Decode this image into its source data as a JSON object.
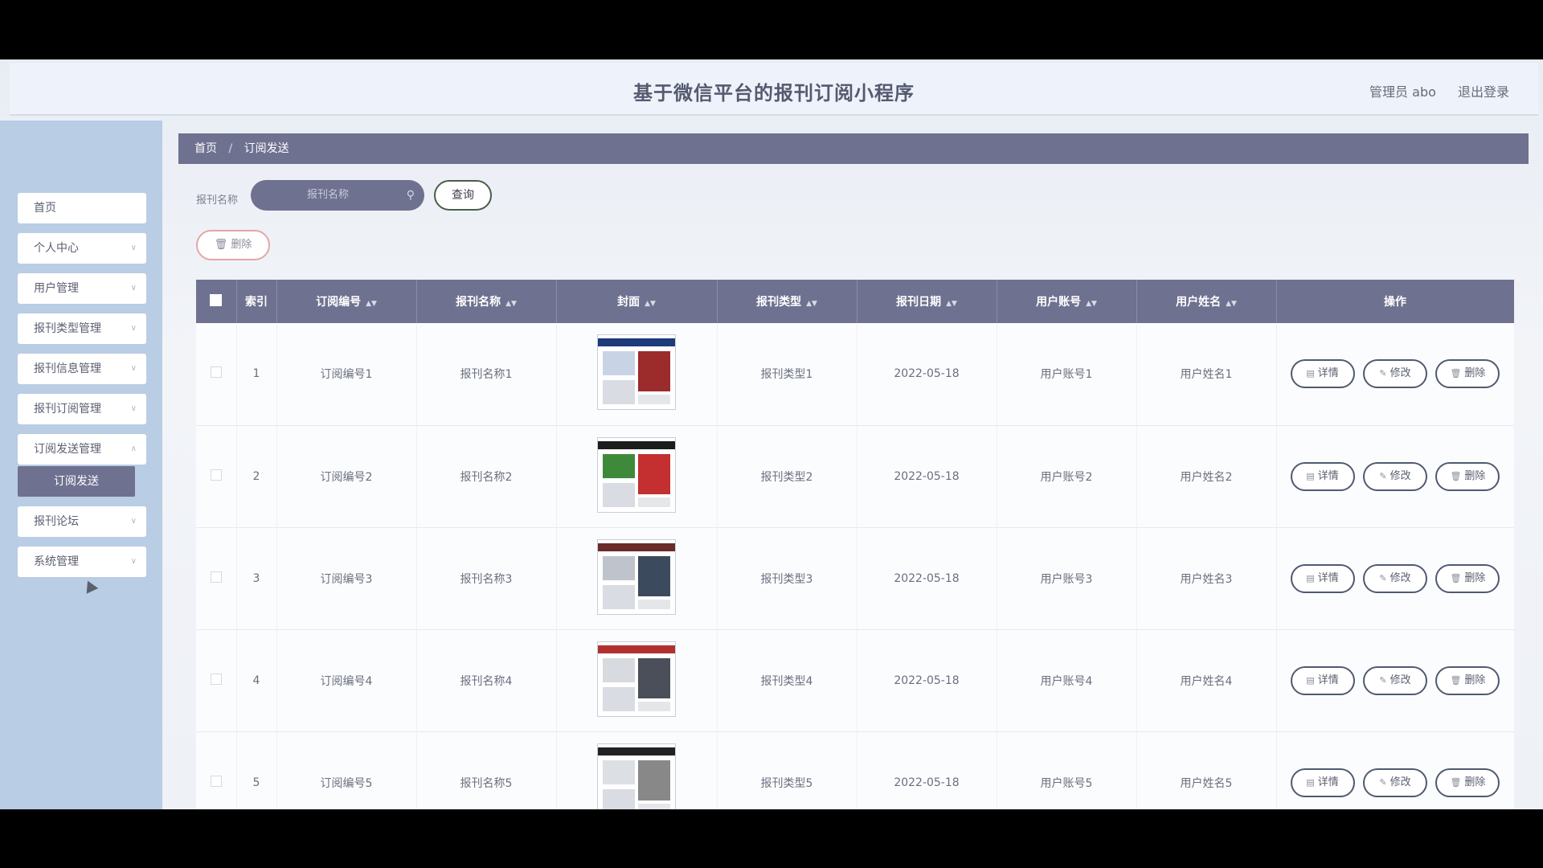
{
  "header": {
    "title": "基于微信平台的报刊订阅小程序",
    "admin_label": "管理员 abo",
    "logout_label": "退出登录"
  },
  "sidebar": {
    "items": [
      {
        "label": "首页"
      },
      {
        "label": "个人中心"
      },
      {
        "label": "用户管理"
      },
      {
        "label": "报刊类型管理"
      },
      {
        "label": "报刊信息管理"
      },
      {
        "label": "报刊订阅管理"
      },
      {
        "label": "订阅发送管理"
      },
      {
        "label": "报刊论坛"
      },
      {
        "label": "系统管理"
      }
    ],
    "active_sub": "订阅发送"
  },
  "breadcrumb": {
    "home": "首页",
    "separator": "/",
    "current": "订阅发送"
  },
  "search": {
    "label": "报刊名称",
    "placeholder": "报刊名称",
    "query_label": "查询"
  },
  "actions": {
    "delete_label": "删除"
  },
  "table": {
    "headers": [
      "索引",
      "订阅编号",
      "报刊名称",
      "封面",
      "报刊类型",
      "报刊日期",
      "用户账号",
      "用户姓名",
      "操作"
    ],
    "rows": [
      {
        "index": "1",
        "sub_no": "订阅编号1",
        "name": "报刊名称1",
        "type": "报刊类型1",
        "date": "2022-05-18",
        "account": "用户账号1",
        "username": "用户姓名1"
      },
      {
        "index": "2",
        "sub_no": "订阅编号2",
        "name": "报刊名称2",
        "type": "报刊类型2",
        "date": "2022-05-18",
        "account": "用户账号2",
        "username": "用户姓名2"
      },
      {
        "index": "3",
        "sub_no": "订阅编号3",
        "name": "报刊名称3",
        "type": "报刊类型3",
        "date": "2022-05-18",
        "account": "用户账号3",
        "username": "用户姓名3"
      },
      {
        "index": "4",
        "sub_no": "订阅编号4",
        "name": "报刊名称4",
        "type": "报刊类型4",
        "date": "2022-05-18",
        "account": "用户账号4",
        "username": "用户姓名4"
      },
      {
        "index": "5",
        "sub_no": "订阅编号5",
        "name": "报刊名称5",
        "type": "报刊类型5",
        "date": "2022-05-18",
        "account": "用户账号5",
        "username": "用户姓名5"
      }
    ],
    "row_actions": {
      "detail": "详情",
      "edit": "修改",
      "delete": "删除"
    }
  },
  "colors": {
    "accent": "#6f7190",
    "sidebar_bg": "#b9cde4",
    "header_bg": "#eef3fb"
  }
}
